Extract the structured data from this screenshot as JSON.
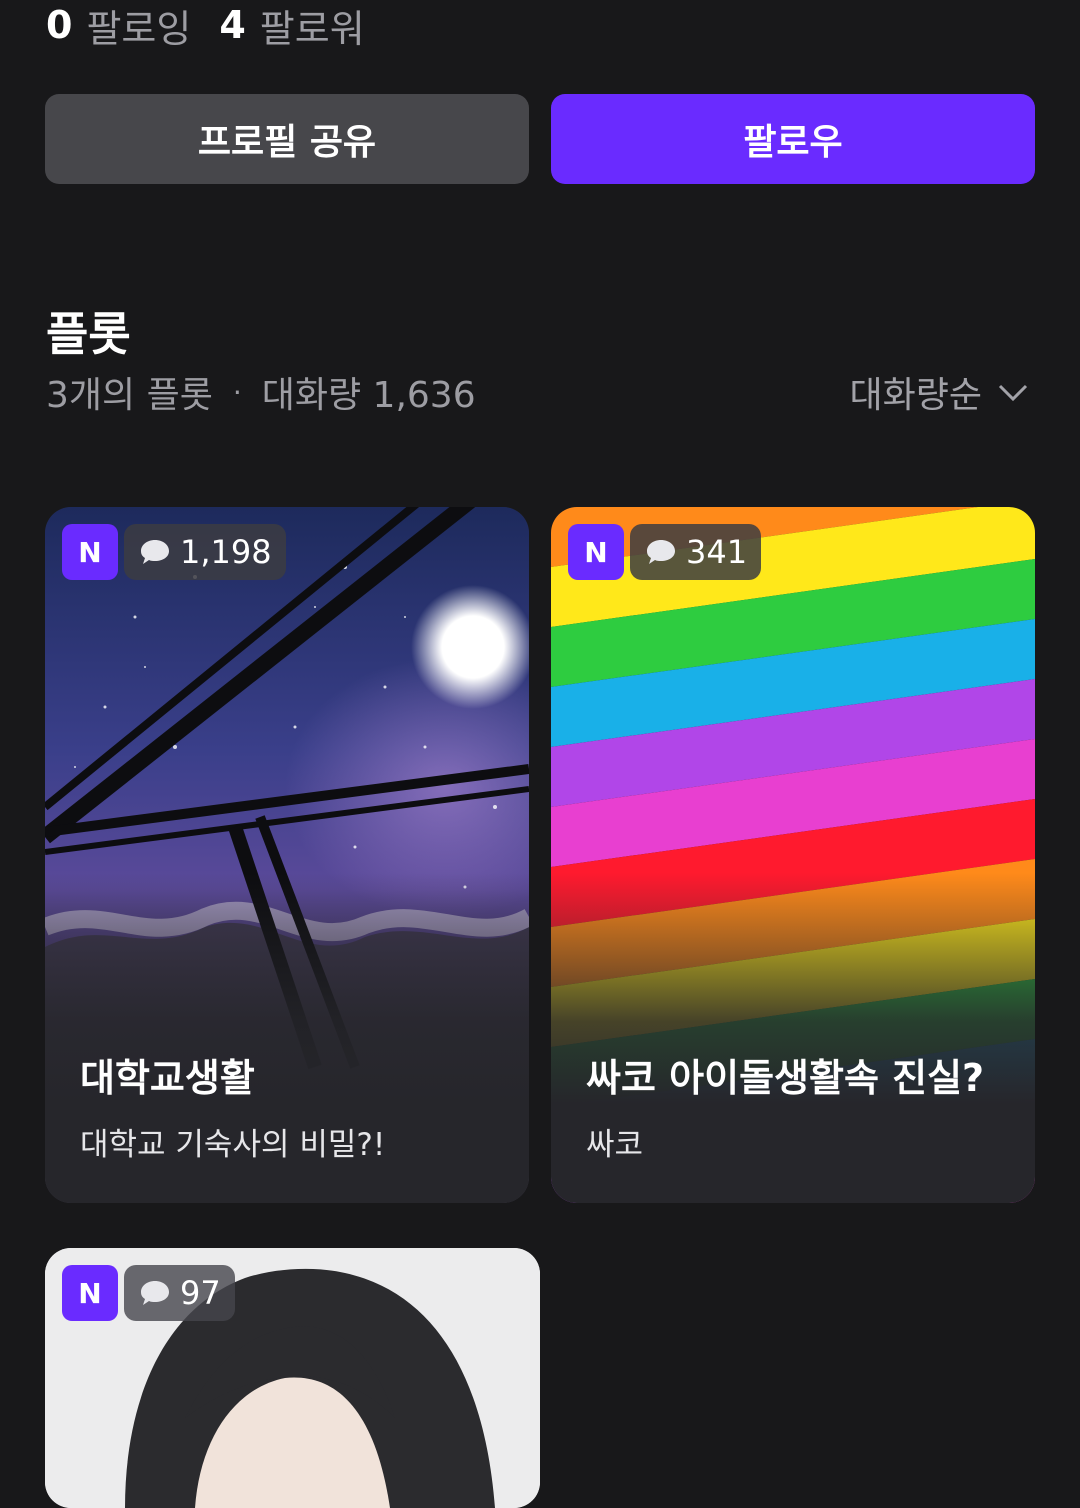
{
  "profile": {
    "following_count": "0",
    "following_label": "팔로잉",
    "followers_count": "4",
    "followers_label": "팔로워",
    "share_button": "프로필 공유",
    "follow_button": "팔로우",
    "accent_color": "#6a2bff"
  },
  "section": {
    "title": "플롯",
    "count_text": "3개의 플롯",
    "separator": "·",
    "volume_text": "대화량 1,636",
    "sort_label": "대화량순",
    "sort_icon": "chevron-down-icon"
  },
  "cards": [
    {
      "badge": "N",
      "chat_count": "1,198",
      "title": "대학교생활",
      "description": "대학교 기숙사의 비밀?!"
    },
    {
      "badge": "N",
      "chat_count": "341",
      "title": "싸코 아이돌생활속 진실?",
      "description": "싸코"
    },
    {
      "badge": "N",
      "chat_count": "97",
      "title": "",
      "description": ""
    }
  ]
}
